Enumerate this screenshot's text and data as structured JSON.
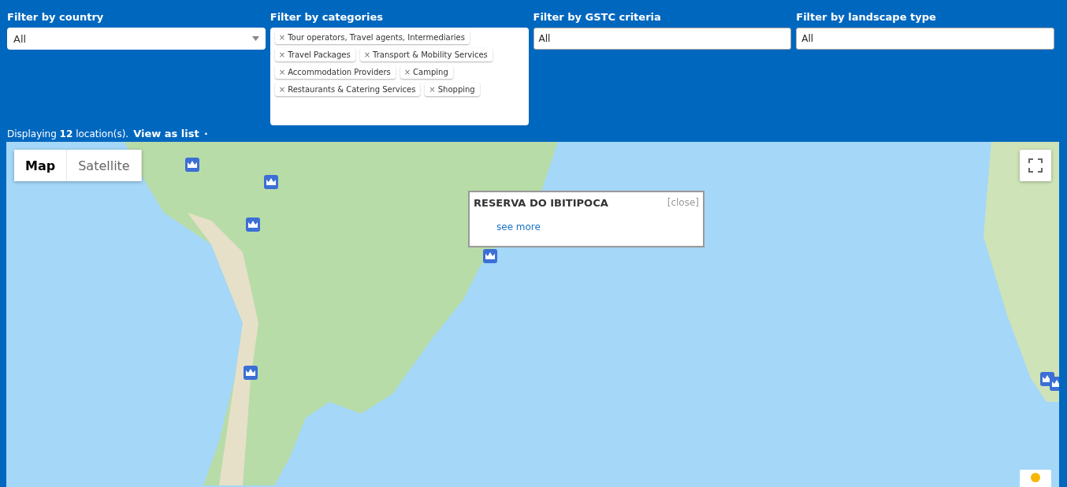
{
  "filters": [
    {
      "kind": "select",
      "label": "Filter by country",
      "value": "All"
    },
    {
      "kind": "tags",
      "label": "Filter by categories",
      "tags": [
        {
          "remove": "×",
          "text": "Tour operators, Travel agents, Intermediaries"
        },
        {
          "remove": "×",
          "text": "Travel Packages"
        },
        {
          "remove": "×",
          "text": "Transport & Mobility Services"
        },
        {
          "remove": "×",
          "text": "Accommodation Providers"
        },
        {
          "remove": "×",
          "text": "Camping"
        },
        {
          "remove": "×",
          "text": "Restaurants & Catering Services"
        },
        {
          "remove": "×",
          "text": "Shopping"
        }
      ]
    },
    {
      "kind": "input",
      "label": "Filter by GSTC criteria",
      "value": "All"
    },
    {
      "kind": "input",
      "label": "Filter by landscape type",
      "value": "All"
    }
  ],
  "summary": {
    "text": "Displaying **12** location(s).",
    "link": "View as list",
    "bullet": "•"
  },
  "map": {
    "types": [
      {
        "label": "Map",
        "selected": true
      },
      {
        "label": "Satellite",
        "selected": false
      }
    ],
    "popup": {
      "title": "RESERVA DO IBITIPOCA",
      "close": "[close]",
      "link": "see more"
    }
  }
}
